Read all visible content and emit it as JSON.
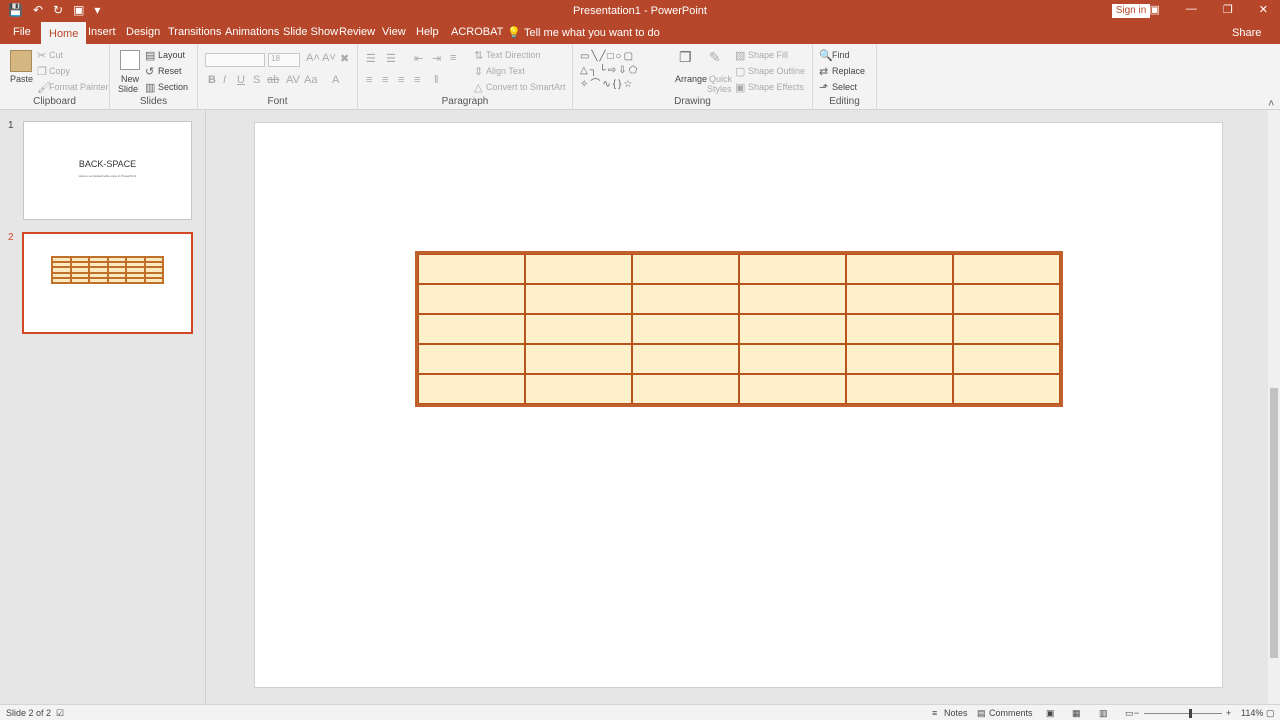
{
  "window": {
    "title": "Presentation1  -  PowerPoint",
    "sign_in": "Sign in",
    "share": "Share"
  },
  "tabs": [
    "File",
    "Home",
    "Insert",
    "Design",
    "Transitions",
    "Animations",
    "Slide Show",
    "Review",
    "View",
    "Help",
    "ACROBAT"
  ],
  "tell_me": "Tell me what you want to do",
  "ribbon": {
    "clipboard": {
      "label": "Clipboard",
      "paste": "Paste",
      "cut": "Cut",
      "copy": "Copy",
      "format_painter": "Format Painter"
    },
    "slides": {
      "label": "Slides",
      "new_slide": "New",
      "new_slide_2": "Slide",
      "layout": "Layout",
      "reset": "Reset",
      "section": "Section"
    },
    "font": {
      "label": "Font",
      "font_name": "",
      "font_size": "18"
    },
    "paragraph": {
      "label": "Paragraph",
      "text_direction": "Text Direction",
      "align_text": "Align Text",
      "convert_smartart": "Convert to SmartArt"
    },
    "drawing": {
      "label": "Drawing",
      "arrange": "Arrange",
      "quick": "Quick",
      "styles": "Styles",
      "shape_fill": "Shape Fill",
      "shape_outline": "Shape Outline",
      "shape_effects": "Shape Effects"
    },
    "editing": {
      "label": "Editing",
      "find": "Find",
      "replace": "Replace",
      "select": "Select"
    }
  },
  "thumbnails": [
    {
      "number": "1",
      "title": "BACK-SPACE",
      "subtitle": "How to set default table style in PowerPoint"
    },
    {
      "number": "2"
    }
  ],
  "table": {
    "rows": 5,
    "columns": 6,
    "fill_color": "#fff2cc",
    "border_color": "#c0602a"
  },
  "status": {
    "slide_info": "Slide 2 of 2",
    "notes": "Notes",
    "comments": "Comments",
    "zoom": "114%"
  },
  "colors": {
    "accent": "#b7472a"
  }
}
